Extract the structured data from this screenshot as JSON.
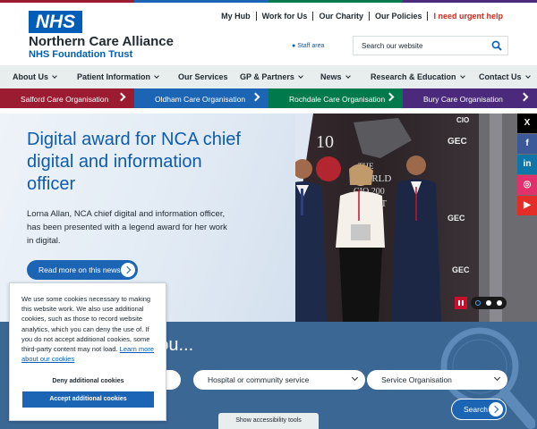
{
  "brand": {
    "logo": "NHS",
    "name": "Northern Care Alliance",
    "sub": "NHS Foundation Trust",
    "logo_color": "#005eb8"
  },
  "top_links": [
    "My Hub",
    "Work for Us",
    "Our Charity",
    "Our Policies",
    "I need urgent help"
  ],
  "staff_area": "Staff area",
  "search": {
    "placeholder": "Search our website"
  },
  "main_nav": [
    "About Us",
    "Patient Information",
    "Our Services",
    "GP & Partners",
    "News",
    "Research & Education",
    "Contact Us"
  ],
  "care_orgs": [
    {
      "label": "Salford Care Organisation",
      "color": "#9b1b30"
    },
    {
      "label": "Oldham Care Organisation",
      "color": "#1c64b4"
    },
    {
      "label": "Rochdale Care Organisation",
      "color": "#007a4d"
    },
    {
      "label": "Bury Care Organisation",
      "color": "#4b2a7b"
    }
  ],
  "hero": {
    "title": "Digital award for NCA chief digital and information officer",
    "text": "Lorna Allan, NCA chief digital and information officer, has been presented with a legend award for her work in digital.",
    "button": "Read more on this news"
  },
  "carousel": {
    "slides": 3,
    "active": 1
  },
  "social": [
    {
      "icon": "x-icon",
      "glyph": "X",
      "color": "#000000"
    },
    {
      "icon": "facebook-icon",
      "glyph": "f",
      "color": "#3b5998"
    },
    {
      "icon": "linkedin-icon",
      "glyph": "in",
      "color": "#0e76a8"
    },
    {
      "icon": "instagram-icon",
      "glyph": "◎",
      "color": "#e1306c"
    },
    {
      "icon": "youtube-icon",
      "glyph": "▶",
      "color": "#e52d27"
    }
  ],
  "care_search": {
    "title": "r you...",
    "select_1": "Hospital or community service",
    "select_2": "Service Organisation",
    "button": "Search"
  },
  "accessibility": "Show accessibility tools",
  "cookie": {
    "text": "We use some cookies necessary to making this website work. We also use additional cookies, such as those to record website analytics, which you can deny the use of. If you do not accept additional cookies, some third-party content may not load.",
    "link": "Learn more about our cookies",
    "deny": "Deny additional cookies",
    "accept": "Accept additional cookies"
  }
}
